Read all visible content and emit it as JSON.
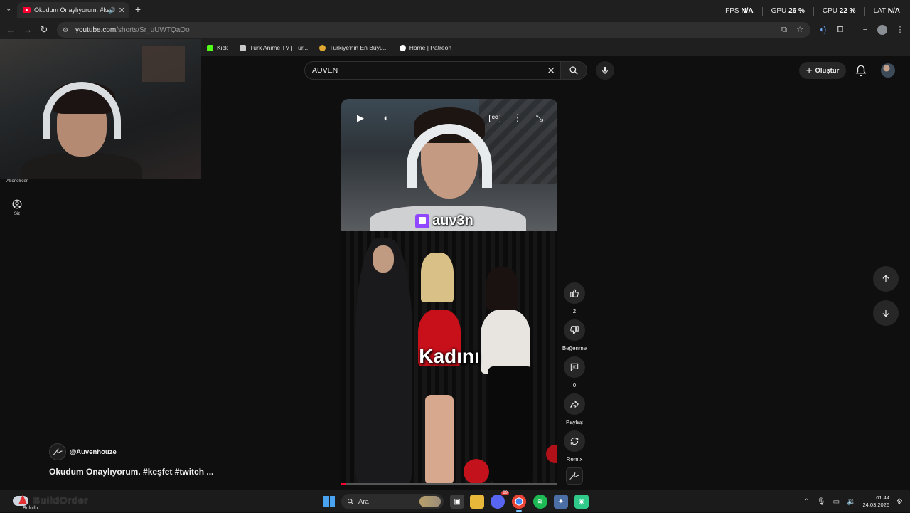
{
  "browser": {
    "tab_title": "Okudum Onaylıyorum. #keş",
    "tab_close": "✕",
    "new_tab": "+",
    "url_host": "youtube.com",
    "url_path": "/shorts/Sr_uUWTQaQo",
    "bookmarks": [
      {
        "label": "Kick",
        "color": "#53fc18"
      },
      {
        "label": "Türk Anime TV | Tür...",
        "color": "#c9c9c9"
      },
      {
        "label": "Türkiye'nin En Büyü...",
        "color": "#e0a830"
      },
      {
        "label": "Home | Patreon",
        "color": "#ffffff"
      }
    ]
  },
  "perf_overlay": {
    "fps_label": "FPS",
    "fps_value": "N/A",
    "gpu_label": "GPU",
    "gpu_value": "26 %",
    "cpu_label": "CPU",
    "cpu_value": "22 %",
    "lat_label": "LAT",
    "lat_value": "N/A"
  },
  "left_nav": {
    "subscriptions_label": "Abonelikler",
    "you_label": "Siz"
  },
  "header": {
    "search_value": "AUVEN",
    "create_label": "Oluştur"
  },
  "video": {
    "overlay_tag": "auv3n",
    "caption": "Kadını",
    "progress": 0.02
  },
  "actions": {
    "like_count": "2",
    "dislike_label": "Beğenme",
    "comment_count": "0",
    "share_label": "Paylaş",
    "remix_label": "Remix"
  },
  "channel": {
    "handle": "@Auvenhouze",
    "video_title": "Okudum Onaylıyorum. #keşfet #twitch ..."
  },
  "taskbar": {
    "weather_text": "BuildOrder",
    "weather_sub": "Bulutlu",
    "search_placeholder": "Ara",
    "discord_badge": "99",
    "time": "01:44",
    "date": "24.03.2026"
  },
  "colors": {
    "accent_red": "#ff0033",
    "twitch_purple": "#9146ff",
    "background": "#0f0f0f"
  }
}
